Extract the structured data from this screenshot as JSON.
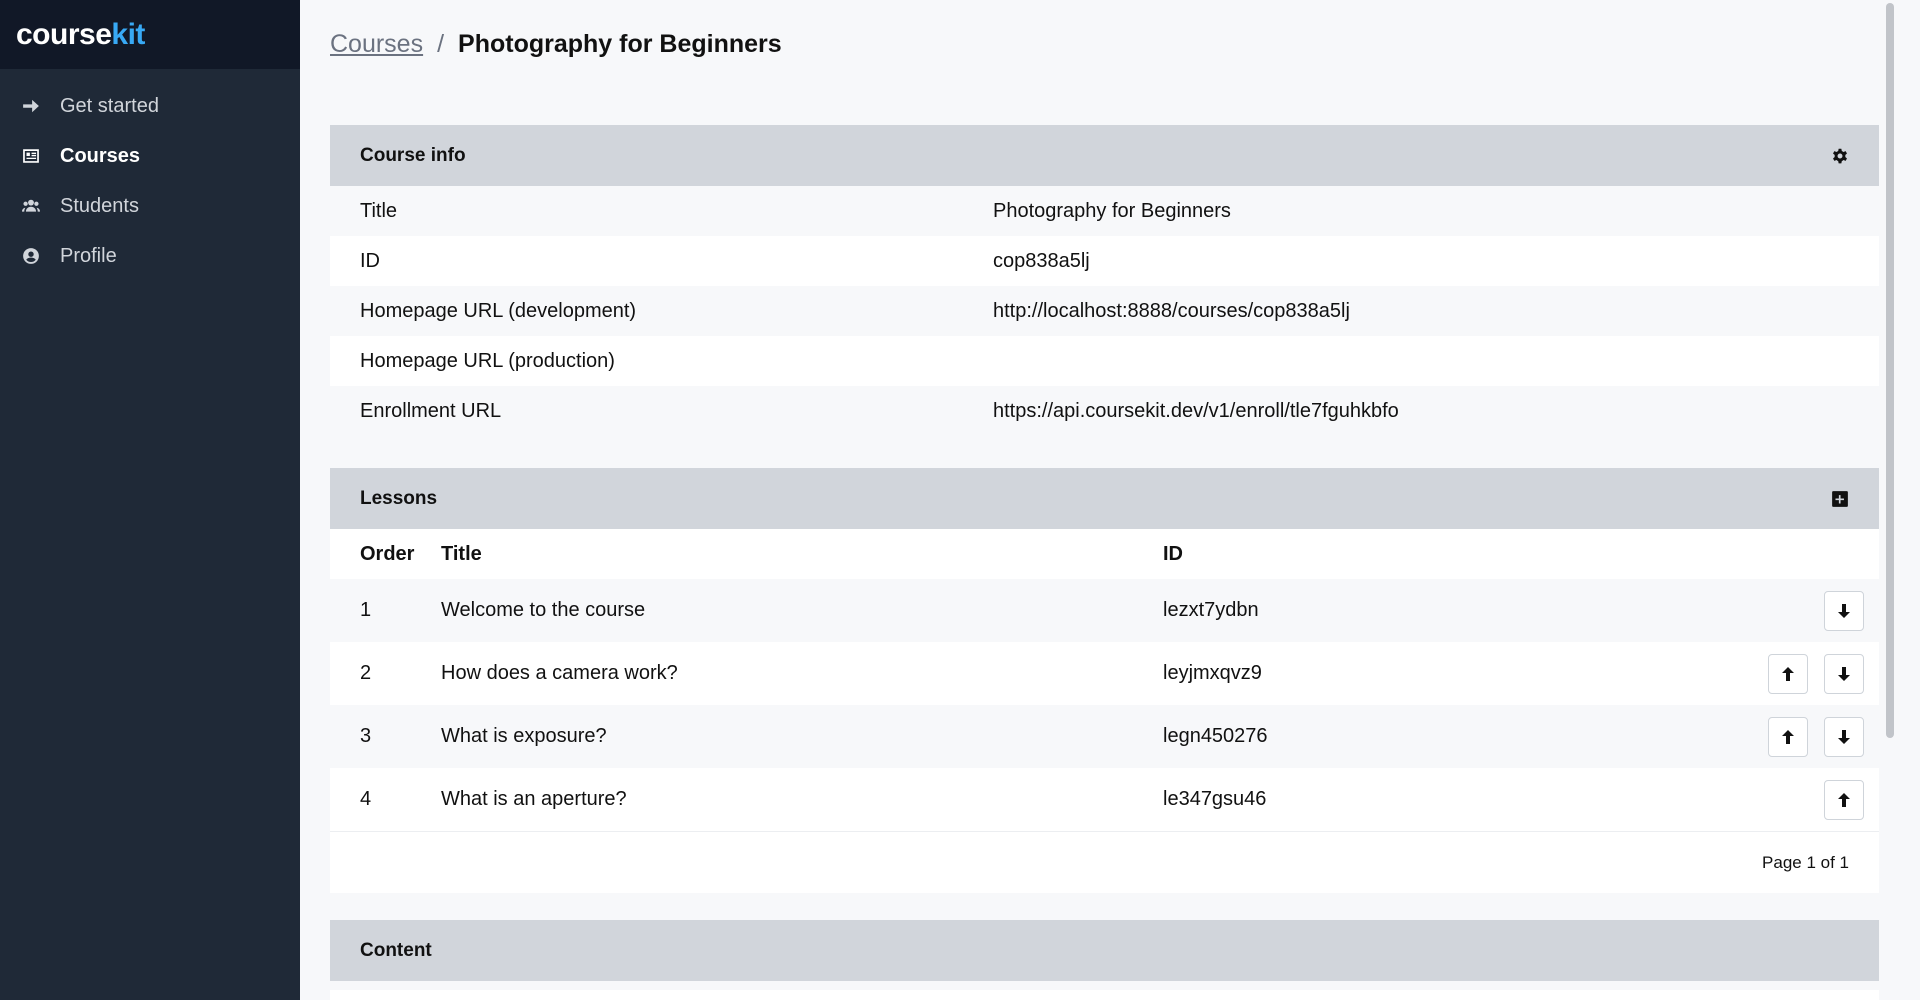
{
  "brand": {
    "part1": "course",
    "part2": "kit"
  },
  "sidebar": {
    "items": [
      {
        "label": "Get started",
        "icon": "arrow-right-icon",
        "active": false
      },
      {
        "label": "Courses",
        "icon": "courses-icon",
        "active": true
      },
      {
        "label": "Students",
        "icon": "users-icon",
        "active": false
      },
      {
        "label": "Profile",
        "icon": "user-circle-icon",
        "active": false
      }
    ]
  },
  "breadcrumb": {
    "parent": "Courses",
    "separator": "/",
    "current": "Photography for Beginners"
  },
  "course_info": {
    "title": "Course info",
    "settings_icon": "gear-icon",
    "rows": [
      {
        "label": "Title",
        "value": "Photography for Beginners"
      },
      {
        "label": "ID",
        "value": "cop838a5lj"
      },
      {
        "label": "Homepage URL (development)",
        "value": "http://localhost:8888/courses/cop838a5lj"
      },
      {
        "label": "Homepage URL (production)",
        "value": ""
      },
      {
        "label": "Enrollment URL",
        "value": "https://api.coursekit.dev/v1/enroll/tle7fguhkbfo"
      }
    ]
  },
  "lessons": {
    "title": "Lessons",
    "add_icon": "plus-square-icon",
    "columns": {
      "order": "Order",
      "title": "Title",
      "id": "ID"
    },
    "rows": [
      {
        "order": "1",
        "title": "Welcome to the course",
        "id": "lezxt7ydbn",
        "up": false,
        "down": true
      },
      {
        "order": "2",
        "title": "How does a camera work?",
        "id": "leyjmxqvz9",
        "up": true,
        "down": true
      },
      {
        "order": "3",
        "title": "What is exposure?",
        "id": "legn450276",
        "up": true,
        "down": true
      },
      {
        "order": "4",
        "title": "What is an aperture?",
        "id": "le347gsu46",
        "up": true,
        "down": false
      }
    ],
    "pagination": "Page 1 of 1"
  },
  "content": {
    "title": "Content"
  }
}
